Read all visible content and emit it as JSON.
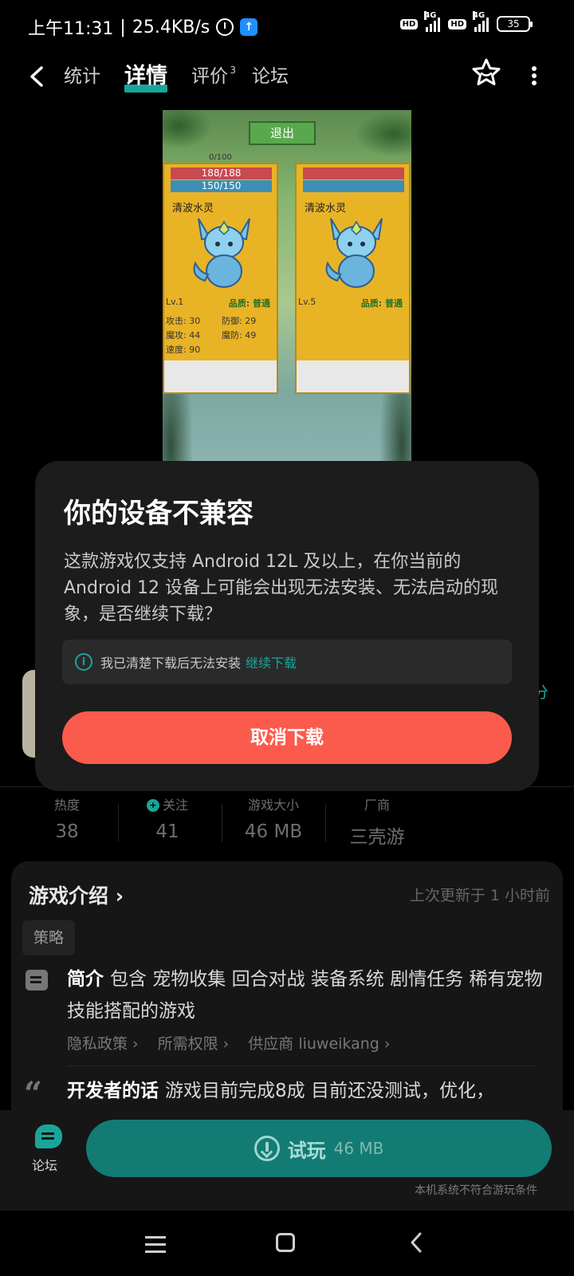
{
  "status_bar": {
    "time": "上午11:31",
    "speed": "25.4KB/s",
    "hd1": "HD",
    "net1": "4G",
    "hd2": "HD",
    "net2": "4G",
    "battery": "35"
  },
  "nav": {
    "tabs": [
      {
        "label": "统计"
      },
      {
        "label": "详情"
      },
      {
        "label": "评价",
        "badge": "3"
      },
      {
        "label": "论坛"
      }
    ],
    "active_tab": "详情"
  },
  "preview": {
    "exit_label": "退出",
    "counter": "0/100",
    "left_card": {
      "hp": "188/188",
      "mp": "150/150",
      "name": "清波水灵",
      "level": "Lv.1",
      "quality": "品质: 普通",
      "attack": "攻击: 30",
      "defense": "防御: 29",
      "magic_attack": "魔攻: 44",
      "magic_defense": "魔防: 49",
      "speed": "速度: 90"
    },
    "right_card": {
      "name": "清波水灵",
      "level": "Lv.5",
      "quality": "品质: 普通"
    }
  },
  "peek": {
    "score_suffix": "分"
  },
  "dialog": {
    "title": "你的设备不兼容",
    "body": "这款游戏仅支持 Android 12L 及以上，在你当前的 Android 12 设备上可能会出现无法安装、无法启动的现象，是否继续下载？",
    "note_text": "我已清楚下载后无法安装",
    "note_link": "继续下载",
    "cancel_label": "取消下载"
  },
  "stats": [
    {
      "label": "热度",
      "value": "38"
    },
    {
      "label": "关注",
      "value": "41"
    },
    {
      "label": "游戏大小",
      "value": "46 MB"
    },
    {
      "label": "厂商",
      "value": "三壳游"
    }
  ],
  "intro": {
    "title": "游戏介绍 ›",
    "updated": "上次更新于 1 小时前",
    "tag": "策略",
    "summary_label": "简介",
    "summary": "包含 宠物收集 回合对战 装备系统 剧情任务 稀有宠物 技能搭配的游戏",
    "links": [
      "隐私政策 ›",
      "所需权限 ›",
      "供应商 liuweikang ›"
    ],
    "dev_label": "开发者的话",
    "dev_text": "游戏目前完成8成 目前还没测试，优化，"
  },
  "action_bar": {
    "forum_label": "论坛",
    "try_label": "试玩",
    "try_size": "46 MB",
    "unmet_note": "本机系统不符合游玩条件"
  }
}
